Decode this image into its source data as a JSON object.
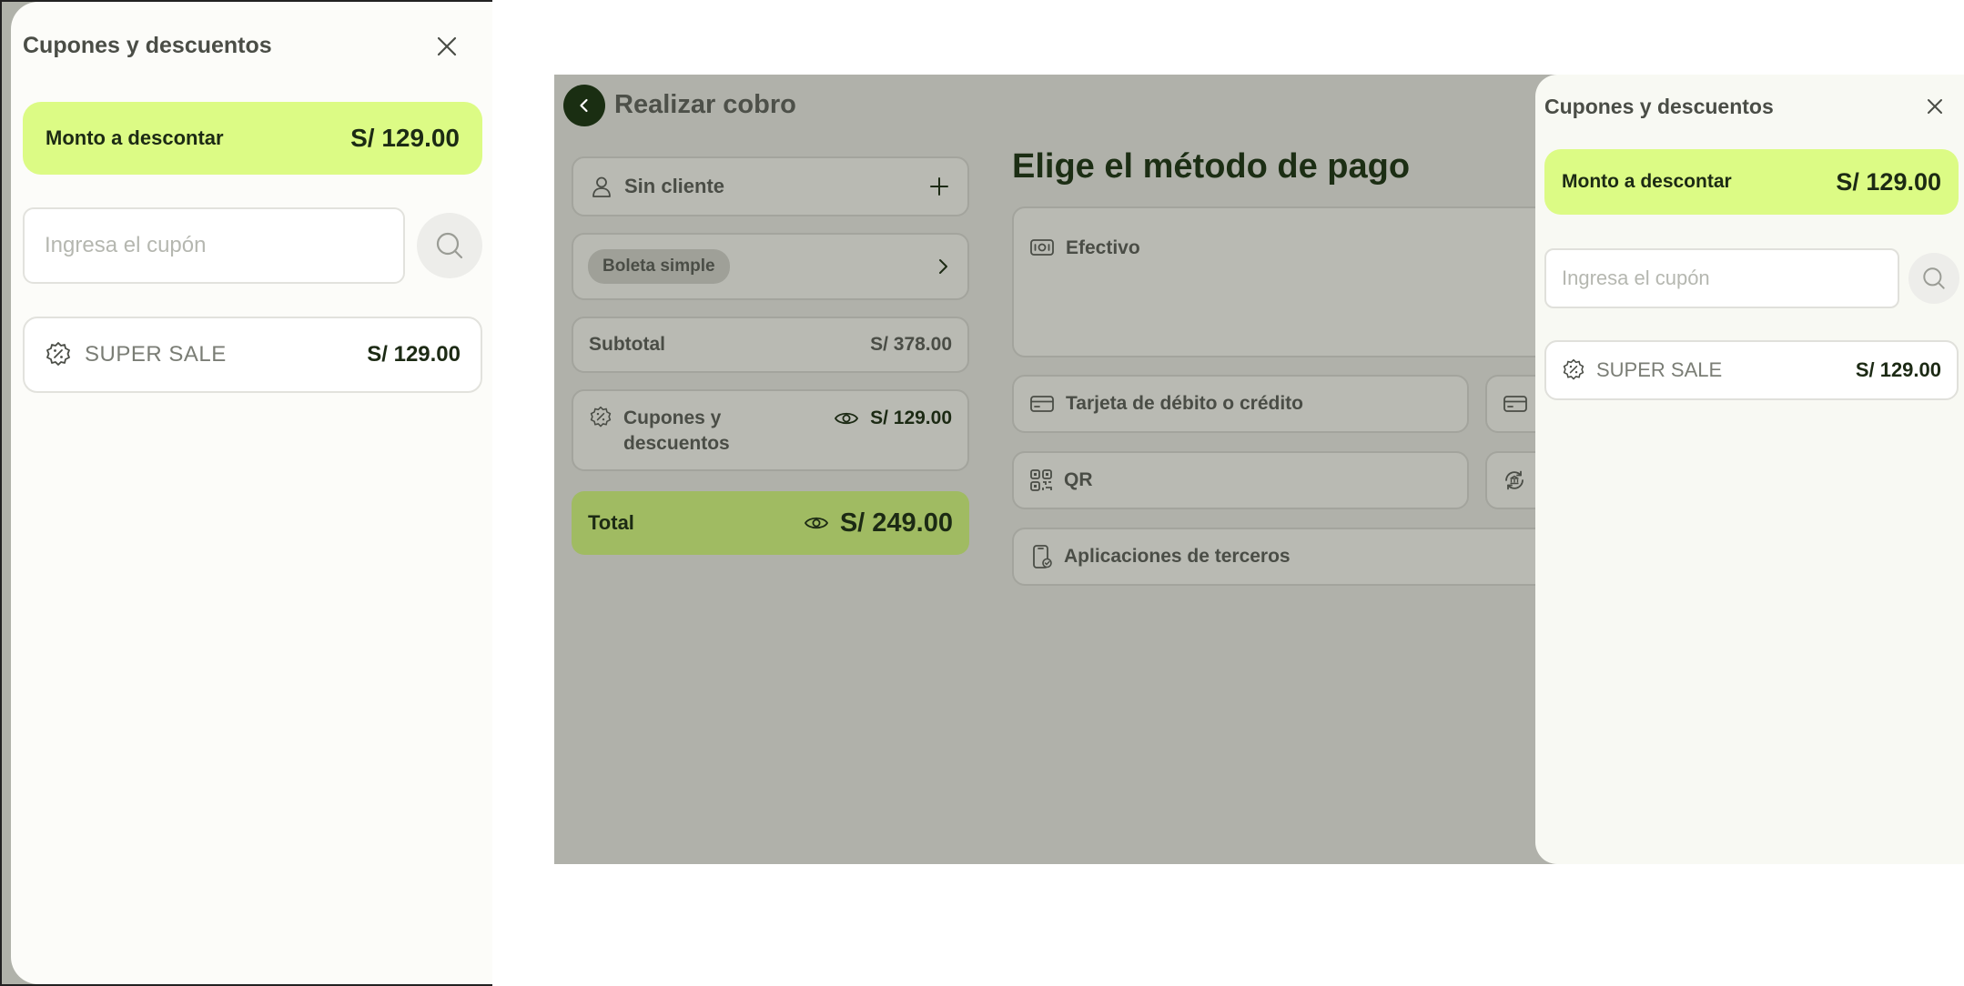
{
  "left_panel": {
    "title": "Cupones y descuentos",
    "amount_label": "Monto a descontar",
    "amount_value": "S/ 129.00",
    "coupon_placeholder": "Ingresa el cupón",
    "coupon": {
      "name": "SUPER SALE",
      "value": "S/ 129.00"
    }
  },
  "main": {
    "title": "Realizar cobro",
    "client": {
      "label": "Sin cliente"
    },
    "document_type": "Boleta simple",
    "subtotal": {
      "label": "Subtotal",
      "value": "S/ 378.00"
    },
    "coupons": {
      "label": "Cupones y descuentos",
      "value": "S/ 129.00"
    },
    "total": {
      "label": "Total",
      "value": "S/ 249.00"
    },
    "payment": {
      "title": "Elige el método de pago",
      "methods": [
        {
          "label": "Efectivo"
        },
        {
          "label": "Tarjeta de débito o crédito"
        },
        {
          "label": "QR"
        },
        {
          "label": "Aplicaciones de terceros"
        }
      ]
    }
  },
  "drawer": {
    "title": "Cupones y descuentos",
    "amount_label": "Monto a descontar",
    "amount_value": "S/ 129.00",
    "coupon_placeholder": "Ingresa el cupón",
    "coupon": {
      "name": "SUPER SALE",
      "value": "S/ 129.00"
    }
  },
  "colors": {
    "accent_lime": "#dcfb85",
    "total_green": "#a0bb62",
    "dark_green": "#1a2e12",
    "overlay_gray": "#b0b1aa"
  },
  "icons": [
    "close-icon",
    "search-icon",
    "discount-badge-icon",
    "chevron-left-icon",
    "user-icon",
    "plus-icon",
    "chevron-right-icon",
    "eye-icon",
    "cash-icon",
    "credit-card-icon",
    "qr-icon",
    "bank-transfer-icon",
    "phone-app-icon"
  ]
}
